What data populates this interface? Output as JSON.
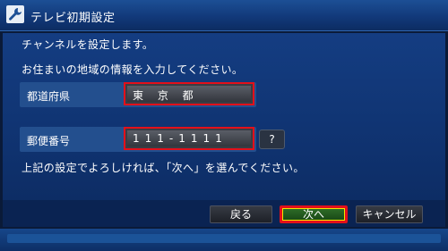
{
  "window": {
    "title": "テレビ初期設定",
    "icon": "wrench-icon"
  },
  "content": {
    "intro_line1": "チャンネルを設定します。",
    "intro_line2": "お住まいの地域の情報を入力してください。",
    "prefecture": {
      "label": "都道府県",
      "value": "東 京 都"
    },
    "postal_code": {
      "label": "郵便番号",
      "value": "111-1111"
    },
    "help_label": "?",
    "instruction": "上記の設定でよろしければ、「次へ」を選んでください。"
  },
  "buttons": {
    "back": "戻る",
    "next": "次へ",
    "cancel": "キャンセル"
  },
  "colors": {
    "highlight": "#e3101a",
    "focus": "#f2e600",
    "panel": "#143d82"
  }
}
